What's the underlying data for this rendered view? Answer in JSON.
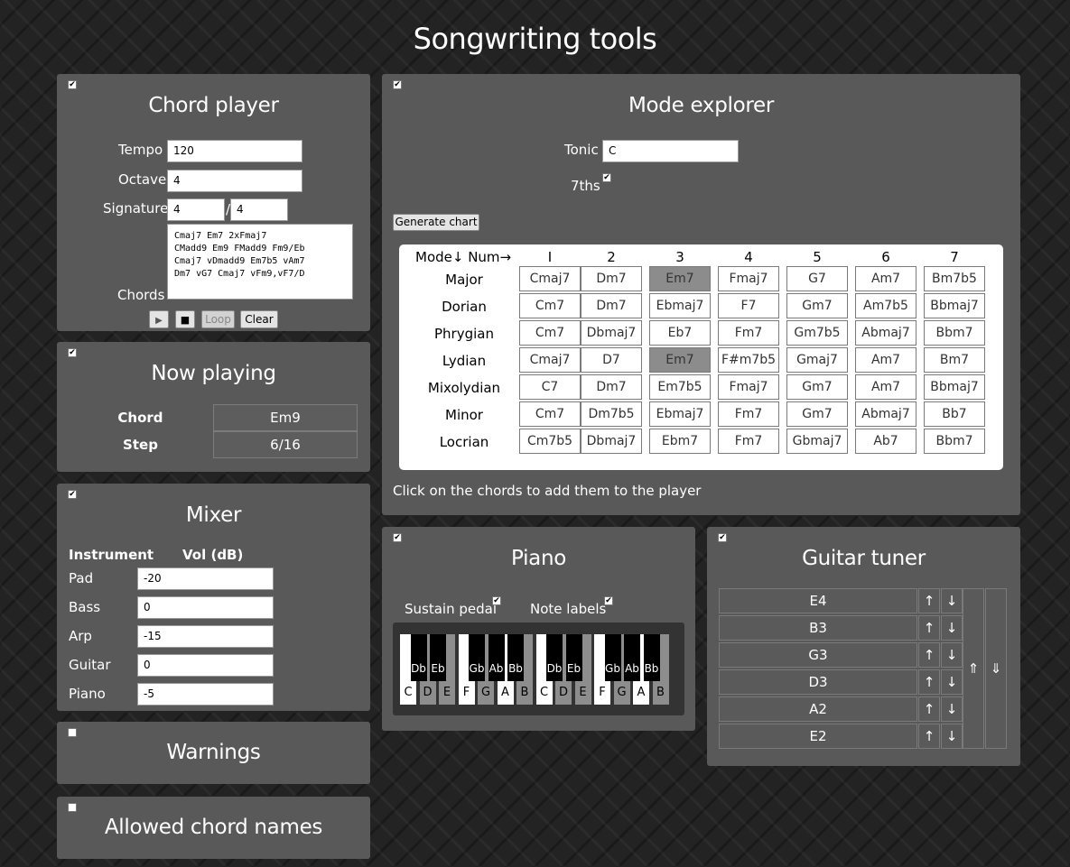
{
  "page_title": "Songwriting tools",
  "chord_player": {
    "title": "Chord player",
    "enabled": true,
    "tempo_label": "Tempo",
    "tempo": "120",
    "octave_label": "Octave",
    "octave": "4",
    "signature_label": "Signature",
    "signature_top": "4",
    "signature_sep": "/",
    "signature_bottom": "4",
    "chords_label": "Chords",
    "chords": "Cmaj7 Em7 2xFmaj7\nCMadd9 Em9 FMadd9 Fm9/Eb\nCmaj7 vDmadd9 Em7b5 vAm7\nDm7 vG7 Cmaj7 vFm9,vF7/D",
    "play_icon": "▶",
    "stop_icon": "■",
    "loop_label": "Loop",
    "clear_label": "Clear"
  },
  "now_playing": {
    "title": "Now playing",
    "enabled": true,
    "chord_label": "Chord",
    "chord": "Em9",
    "step_label": "Step",
    "step": "6/16"
  },
  "mixer": {
    "title": "Mixer",
    "enabled": true,
    "col_instrument": "Instrument",
    "col_vol": "Vol (dB)",
    "rows": [
      {
        "name": "Pad",
        "vol": "-20"
      },
      {
        "name": "Bass",
        "vol": "0"
      },
      {
        "name": "Arp",
        "vol": "-15"
      },
      {
        "name": "Guitar",
        "vol": "0"
      },
      {
        "name": "Piano",
        "vol": "-5"
      }
    ]
  },
  "warnings": {
    "title": "Warnings",
    "enabled": false
  },
  "allowed": {
    "title": "Allowed chord names",
    "enabled": false
  },
  "mode_explorer": {
    "title": "Mode explorer",
    "enabled": true,
    "tonic_label": "Tonic",
    "tonic": "C",
    "sevenths_label": "7ths",
    "sevenths": true,
    "generate_label": "Generate chart",
    "header_mode": "Mode↓ Num→",
    "numerals": [
      "I",
      "2",
      "3",
      "4",
      "5",
      "6",
      "7"
    ],
    "rows": [
      {
        "mode": "Major",
        "chords": [
          "Cmaj7",
          "Dm7",
          "Em7",
          "Fmaj7",
          "G7",
          "Am7",
          "Bm7b5"
        ],
        "highlight": 2
      },
      {
        "mode": "Dorian",
        "chords": [
          "Cm7",
          "Dm7",
          "Ebmaj7",
          "F7",
          "Gm7",
          "Am7b5",
          "Bbmaj7"
        ],
        "highlight": -1
      },
      {
        "mode": "Phrygian",
        "chords": [
          "Cm7",
          "Dbmaj7",
          "Eb7",
          "Fm7",
          "Gm7b5",
          "Abmaj7",
          "Bbm7"
        ],
        "highlight": -1
      },
      {
        "mode": "Lydian",
        "chords": [
          "Cmaj7",
          "D7",
          "Em7",
          "F#m7b5",
          "Gmaj7",
          "Am7",
          "Bm7"
        ],
        "highlight": 2
      },
      {
        "mode": "Mixolydian",
        "chords": [
          "C7",
          "Dm7",
          "Em7b5",
          "Fmaj7",
          "Gm7",
          "Am7",
          "Bbmaj7"
        ],
        "highlight": -1
      },
      {
        "mode": "Minor",
        "chords": [
          "Cm7",
          "Dm7b5",
          "Ebmaj7",
          "Fm7",
          "Gm7",
          "Abmaj7",
          "Bb7"
        ],
        "highlight": -1
      },
      {
        "mode": "Locrian",
        "chords": [
          "Cm7b5",
          "Dbmaj7",
          "Ebm7",
          "Fm7",
          "Gbmaj7",
          "Ab7",
          "Bbm7"
        ],
        "highlight": -1
      }
    ],
    "hint": "Click on the chords to add them to the player"
  },
  "piano": {
    "title": "Piano",
    "enabled": true,
    "sustain_label": "Sustain pedal",
    "sustain": true,
    "labels_label": "Note labels",
    "labels": true,
    "white_keys": [
      {
        "note": "C",
        "lit": true
      },
      {
        "note": "D",
        "lit": false
      },
      {
        "note": "E",
        "lit": false
      },
      {
        "note": "F",
        "lit": true
      },
      {
        "note": "G",
        "lit": false
      },
      {
        "note": "A",
        "lit": true
      },
      {
        "note": "B",
        "lit": false
      },
      {
        "note": "C",
        "lit": true
      },
      {
        "note": "D",
        "lit": false
      },
      {
        "note": "E",
        "lit": false
      },
      {
        "note": "F",
        "lit": true
      },
      {
        "note": "G",
        "lit": false
      },
      {
        "note": "A",
        "lit": true
      },
      {
        "note": "B",
        "lit": false
      }
    ],
    "black_keys": [
      "Db",
      "Eb",
      "Gb",
      "Ab",
      "Bb",
      "Db",
      "Eb",
      "Gb",
      "Ab",
      "Bb"
    ]
  },
  "tuner": {
    "title": "Guitar tuner",
    "enabled": true,
    "strings": [
      "E4",
      "B3",
      "G3",
      "D3",
      "A2",
      "E2"
    ],
    "up_icon": "↑",
    "down_icon": "↓",
    "all_up_icon": "⇑",
    "all_down_icon": "⇓"
  }
}
